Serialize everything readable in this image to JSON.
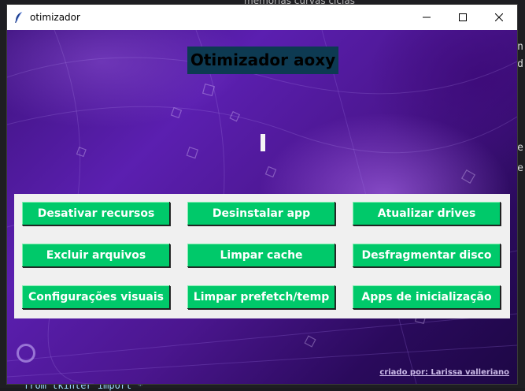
{
  "background": {
    "top_text": "memorias curvas ciclas",
    "right_chars": [
      "n",
      "d",
      "e",
      "e"
    ],
    "bottom_text": "from tkinter import *"
  },
  "window": {
    "title": "otimizador",
    "controls": {
      "minimize": "minimize-icon",
      "maximize": "maximize-icon",
      "close": "close-icon"
    }
  },
  "app": {
    "heading": "Otimizador aoxy",
    "buttons": [
      "Desativar recursos",
      "Desinstalar app",
      "Atualizar drives",
      "Excluir arquivos",
      "Limpar cache",
      "Desfragmentar disco",
      "Configurações visuais",
      "Limpar prefetch/temp",
      "Apps de inicialização"
    ],
    "credit": "criado por: Larissa valleriano"
  },
  "colors": {
    "button_bg": "#00c96a",
    "heading_bg": "#0d3a52",
    "panel_bg": "#f0f0f0",
    "background_purple": "#4b168f"
  }
}
